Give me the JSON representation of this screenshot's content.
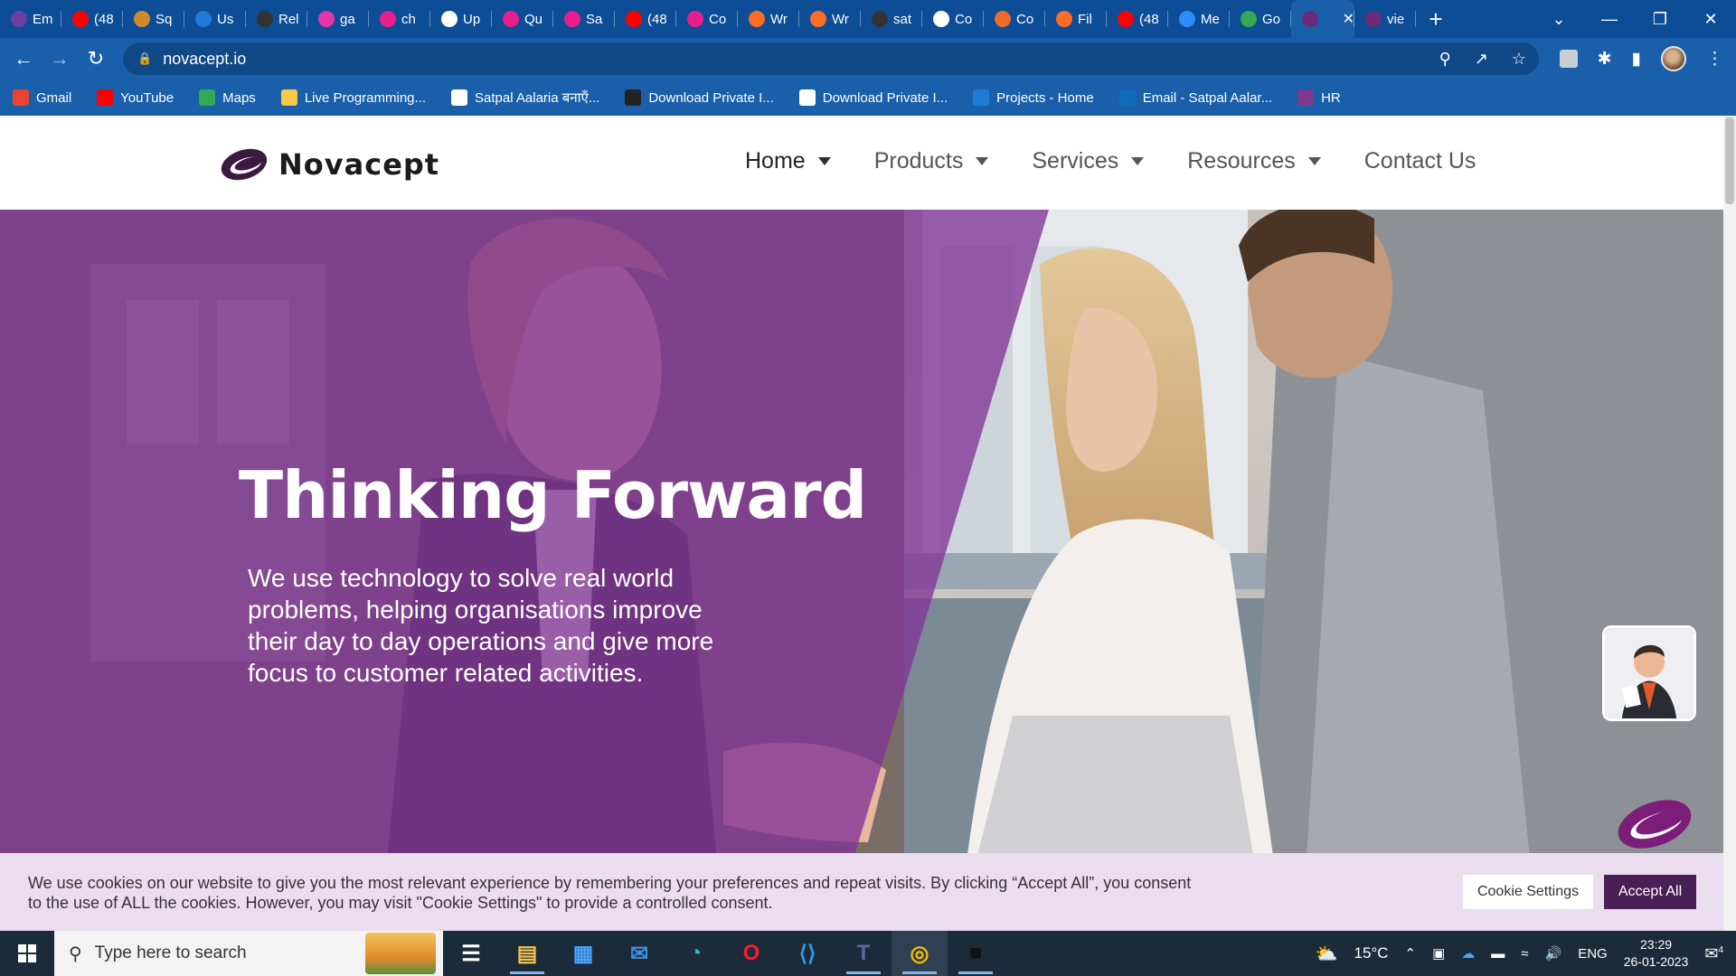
{
  "browser": {
    "tabs": [
      {
        "title": "Em",
        "icon": "wave-icon",
        "color": "#6b3fa0"
      },
      {
        "title": "(48",
        "icon": "youtube-icon",
        "color": "#ff0000"
      },
      {
        "title": "Sq",
        "icon": "squarespace-icon",
        "color": "#d08a2b"
      },
      {
        "title": "Us",
        "icon": "azure-devops-icon",
        "color": "#1f7bd8"
      },
      {
        "title": "Rel",
        "icon": "github-icon",
        "color": "#333333"
      },
      {
        "title": "ga",
        "icon": "graphql-icon",
        "color": "#e535ab"
      },
      {
        "title": "ch",
        "icon": "h-icon",
        "color": "#e91e8c"
      },
      {
        "title": "Up",
        "icon": "arrow-up-icon",
        "color": "#ffffff"
      },
      {
        "title": "Qu",
        "icon": "h-icon",
        "color": "#e91e8c"
      },
      {
        "title": "Sa",
        "icon": "h-icon",
        "color": "#e91e8c"
      },
      {
        "title": "(48",
        "icon": "youtube-icon",
        "color": "#ff0000"
      },
      {
        "title": "Co",
        "icon": "h-icon",
        "color": "#e91e8c"
      },
      {
        "title": "Wr",
        "icon": "gitlab-icon",
        "color": "#fc6d26"
      },
      {
        "title": "Wr",
        "icon": "gitlab-icon",
        "color": "#fc6d26"
      },
      {
        "title": "sat",
        "icon": "github-icon",
        "color": "#333333"
      },
      {
        "title": "Co",
        "icon": "globe-icon",
        "color": "#ffffff"
      },
      {
        "title": "Co",
        "icon": "cloud-icon",
        "color": "#f06a2b"
      },
      {
        "title": "Fil",
        "icon": "gitlab-icon",
        "color": "#fc6d26"
      },
      {
        "title": "(48",
        "icon": "youtube-icon",
        "color": "#ff0000"
      },
      {
        "title": "Me",
        "icon": "chat-icon",
        "color": "#2d8cff"
      },
      {
        "title": "Go",
        "icon": "google-meet-icon",
        "color": "#34a853"
      },
      {
        "title": "",
        "icon": "novacept-icon",
        "color": "#6b2a7a"
      },
      {
        "title": "vie",
        "icon": "novacept-icon",
        "color": "#6b2a7a"
      }
    ],
    "active_tab_index": 21,
    "url": "novacept.io",
    "bookmarks": [
      {
        "label": "Gmail",
        "icon": "gmail-icon",
        "color": "#ea4335"
      },
      {
        "label": "YouTube",
        "icon": "youtube-icon",
        "color": "#ff0000"
      },
      {
        "label": "Maps",
        "icon": "maps-pin-icon",
        "color": "#34a853"
      },
      {
        "label": "Live Programming...",
        "icon": "python-icon",
        "color": "#f7c948"
      },
      {
        "label": "Satpal Aalaria बनाएँ...",
        "icon": "w-icon",
        "color": "#ffffff"
      },
      {
        "label": "Download Private I...",
        "icon": "id-icon",
        "color": "#222222"
      },
      {
        "label": "Download Private I...",
        "icon": "circle-logo-icon",
        "color": "#ffffff"
      },
      {
        "label": "Projects - Home",
        "icon": "azure-devops-icon",
        "color": "#1f7bd8"
      },
      {
        "label": "Email - Satpal Aalar...",
        "icon": "outlook-icon",
        "color": "#0f6cbd"
      },
      {
        "label": "HR",
        "icon": "novacept-icon",
        "color": "#7b3a8f"
      }
    ]
  },
  "site": {
    "logo_text": "Novacept",
    "nav": [
      {
        "label": "Home",
        "dropdown": true
      },
      {
        "label": "Products",
        "dropdown": true
      },
      {
        "label": "Services",
        "dropdown": true
      },
      {
        "label": "Resources",
        "dropdown": true
      },
      {
        "label": "Contact Us",
        "dropdown": false
      }
    ],
    "hero": {
      "title": "Thinking Forward",
      "text": "We use technology to solve real world problems, helping organisations improve their day to day operations and give more focus to customer related activities."
    },
    "cookie": {
      "text": "We use cookies on our website to give you the most relevant experience by remembering your preferences and repeat visits. By clicking “Accept All”, you consent to the use of ALL the cookies. However, you may visit \"Cookie Settings\" to provide a controlled consent.",
      "settings_label": "Cookie Settings",
      "accept_label": "Accept All"
    },
    "colors": {
      "brand_purple": "#813496",
      "accept_button": "#4a1f56",
      "cookie_bg": "#ecdcef"
    }
  },
  "taskbar": {
    "search_placeholder": "Type here to search",
    "apps": [
      {
        "name": "task-view-icon",
        "running": false
      },
      {
        "name": "file-explorer-icon",
        "running": true
      },
      {
        "name": "microsoft-store-icon",
        "running": false
      },
      {
        "name": "mail-icon",
        "running": false
      },
      {
        "name": "edge-icon",
        "running": false
      },
      {
        "name": "opera-icon",
        "running": false
      },
      {
        "name": "vscode-icon",
        "running": false
      },
      {
        "name": "teams-icon",
        "running": true
      },
      {
        "name": "chrome-icon",
        "running": true
      },
      {
        "name": "terminal-icon",
        "running": true
      }
    ],
    "weather": "15°C",
    "language": "ENG",
    "time": "23:29",
    "date": "26-01-2023",
    "notification_count": "4"
  }
}
